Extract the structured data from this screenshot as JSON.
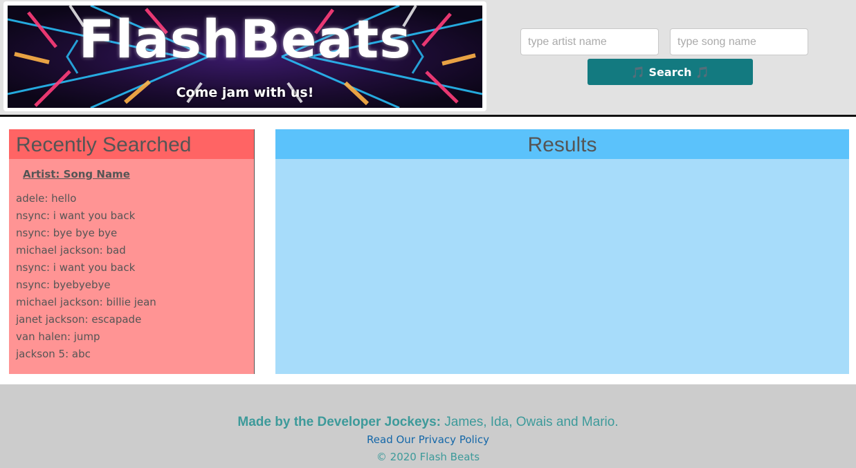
{
  "banner": {
    "title": "FlashBeats",
    "tagline": "Come jam with us!"
  },
  "search": {
    "artist_placeholder": "type artist name",
    "song_placeholder": "type song name",
    "button_label": "🎵 Search 🎵"
  },
  "recent": {
    "title": "Recently Searched",
    "subheader": "Artist: Song Name",
    "items": [
      "adele: hello",
      "nsync: i want you back",
      "nsync: bye bye bye",
      "michael jackson: bad",
      "nsync: i want you back",
      "nsync: byebyebye",
      "michael jackson: billie jean",
      "janet jackson: escapade",
      "van halen: jump",
      "jackson 5: abc"
    ]
  },
  "results": {
    "title": "Results"
  },
  "footer": {
    "credits_strong": "Made by the Developer Jockeys:",
    "credits_names": " James, Ida, Owais and Mario.",
    "privacy_link": "Read Our Privacy Policy",
    "copyright": "© 2020 Flash Beats"
  },
  "colors": {
    "header_bg": "#e2e2e2",
    "search_button": "#137a80",
    "recent_header": "#ff6464",
    "recent_body": "#ff9494",
    "results_header": "#5bc2fb",
    "results_body": "#a7dcfa",
    "footer_bg": "#cccccc"
  }
}
